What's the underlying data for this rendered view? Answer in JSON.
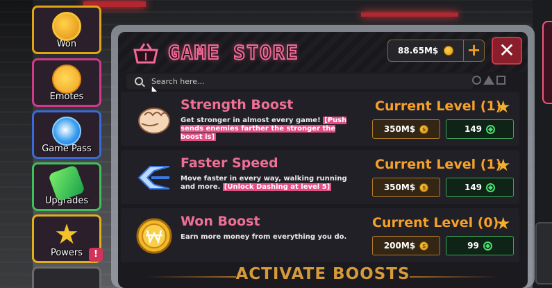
{
  "sidebar": {
    "items": [
      {
        "label": "Won",
        "icon": "won-coin-icon"
      },
      {
        "label": "Emotes",
        "icon": "emote-face-icon"
      },
      {
        "label": "Game Pass",
        "icon": "game-pass-icon"
      },
      {
        "label": "Upgrades",
        "icon": "battery-icon"
      },
      {
        "label": "Powers",
        "icon": "star-icon"
      }
    ],
    "powers_badge": "!"
  },
  "store": {
    "title": "GAME STORE",
    "balance": "88.65M$",
    "plus_label": "+",
    "close_label": "✕",
    "search": {
      "placeholder": "Search here..."
    },
    "items": [
      {
        "name": "Strength Boost",
        "desc": "Get stronger in almost every game!",
        "desc_highlight": "[Push sends enemies farther the stronger the boost is]",
        "level": "Current Level (1)",
        "price_coin": "350M$",
        "price_gem": "149",
        "icon": "fist-icon"
      },
      {
        "name": "Faster Speed",
        "desc": "Move faster in every way, walking running and more.",
        "desc_highlight": "[Unlock Dashing at level 5]",
        "level": "Current Level (1)",
        "price_coin": "350M$",
        "price_gem": "149",
        "icon": "speed-chevron-icon"
      },
      {
        "name": "Won Boost",
        "desc": "Earn more money from everything you do.",
        "desc_highlight": "",
        "level": "Current Level (0)",
        "price_coin": "200M$",
        "price_gem": "99",
        "icon": "won-coin-icon"
      }
    ],
    "footer": "ACTIVATE BOOSTS"
  },
  "colors": {
    "accent_pink": "#ef6f95",
    "level_orange": "#f5a12a",
    "gem_green": "#3ea65a",
    "close_red": "#8b1e2b"
  }
}
